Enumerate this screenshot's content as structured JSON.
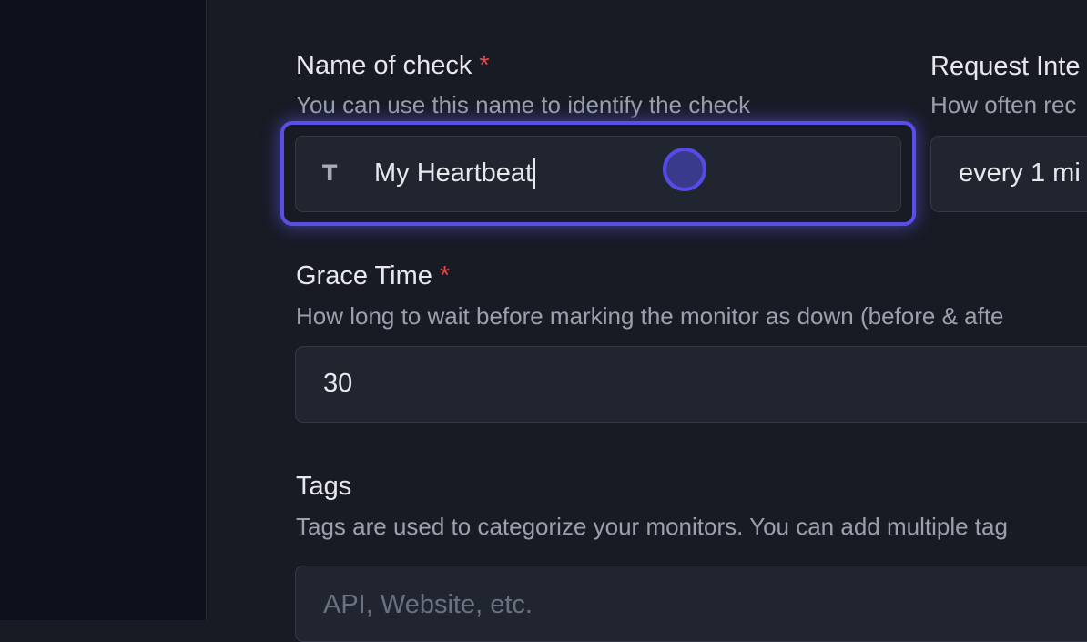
{
  "form": {
    "name_field": {
      "label": "Name of check",
      "required_mark": "*",
      "help": "You can use this name to identify the check",
      "value": "My Heartbeat",
      "icon": "text-type-icon"
    },
    "interval_field": {
      "label": "Request Inte",
      "help": "How often rec",
      "value": "every 1 mi"
    },
    "grace_field": {
      "label": "Grace Time",
      "required_mark": "*",
      "help": "How long to wait before marking the monitor as down (before & afte",
      "value": "30"
    },
    "tags_field": {
      "label": "Tags",
      "help": "Tags are used to categorize your monitors. You can add multiple tag",
      "placeholder": "API, Website, etc."
    }
  },
  "colors": {
    "focus_ring": "#5b4ee6",
    "required": "#e5484d",
    "background": "#181b24",
    "sidebar": "#0c111c"
  }
}
